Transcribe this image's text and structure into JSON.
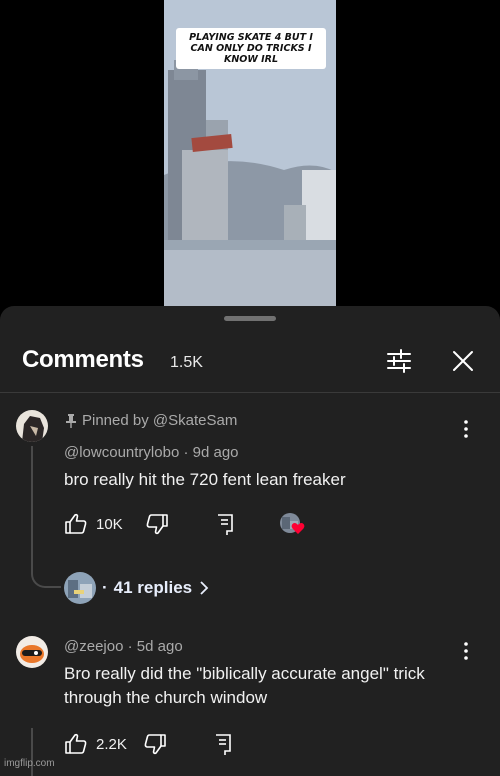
{
  "video": {
    "caption": "Playing Skate 4 but I can only do tricks I know IRL"
  },
  "comments_panel": {
    "title": "Comments",
    "count": "1.5K"
  },
  "comments": [
    {
      "pinned_label": "Pinned by @SkateSam",
      "author": "@lowcountrylobo",
      "age": "9d ago",
      "text": "bro really hit the 720 fent lean freaker",
      "likes": "10K",
      "replies_label": "41 replies"
    },
    {
      "author": "@zeejoo",
      "age": "5d ago",
      "text": "Bro really did the \"biblically accurate angel\" trick through the church window",
      "likes": "2.2K"
    }
  ],
  "separator": "·",
  "watermark": "imgflip.com",
  "colors": {
    "sheet_bg": "#212121",
    "heart": "#ff0033",
    "secondary_text": "#aaaaaa"
  }
}
